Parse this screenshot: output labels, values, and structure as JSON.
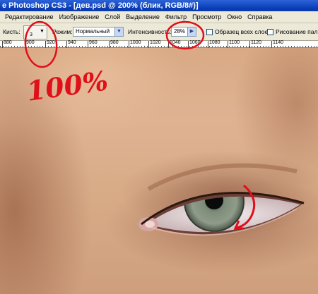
{
  "window": {
    "title": "e Photoshop CS3 - [дев.psd @ 200% (блик, RGB/8#)]"
  },
  "menu": [
    "Редактирование",
    "Изображение",
    "Слой",
    "Выделение",
    "Фильтр",
    "Просмотр",
    "Окно",
    "Справка"
  ],
  "options": {
    "brush_label": "Кисть:",
    "brush_size": "3",
    "mode_label": "Режим:",
    "mode_value": "Нормальный",
    "intensity_label": "Интенсивность:",
    "intensity_value": "28%",
    "sample_all_label": "Образец всех слоев",
    "finger_paint_label": "Рисование пальцем"
  },
  "ruler": {
    "labels": [
      "880",
      "900",
      "920",
      "940",
      "960",
      "980",
      "1000",
      "1020",
      "1040",
      "1060",
      "1080",
      "1100",
      "1120",
      "1140"
    ]
  },
  "annotation": {
    "text": "100%"
  },
  "colors": {
    "annotation": "#e0101a",
    "titlebar": "#0a3fb8",
    "chrome": "#ece9d8"
  },
  "icons": [
    "chevron-down-icon",
    "play-arrow-icon",
    "checkbox-icon"
  ]
}
